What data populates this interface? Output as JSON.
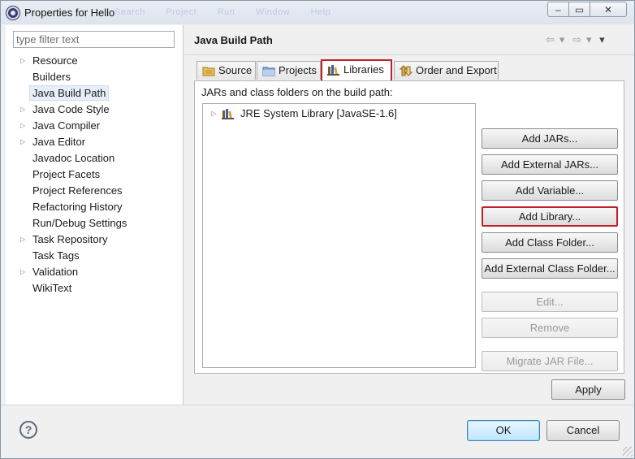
{
  "window": {
    "title": "Properties for Hello",
    "ghost_menu": [
      "Search",
      "Project",
      "Run",
      "Window",
      "Help"
    ],
    "controls": {
      "minimize": "–",
      "maximize": "▭",
      "close": "✕"
    }
  },
  "sidebar": {
    "filter_placeholder": "type filter text",
    "items": [
      {
        "label": "Resource",
        "expandable": true
      },
      {
        "label": "Builders",
        "expandable": false
      },
      {
        "label": "Java Build Path",
        "expandable": false,
        "selected": true
      },
      {
        "label": "Java Code Style",
        "expandable": true
      },
      {
        "label": "Java Compiler",
        "expandable": true
      },
      {
        "label": "Java Editor",
        "expandable": true
      },
      {
        "label": "Javadoc Location",
        "expandable": false
      },
      {
        "label": "Project Facets",
        "expandable": false
      },
      {
        "label": "Project References",
        "expandable": false
      },
      {
        "label": "Refactoring History",
        "expandable": false
      },
      {
        "label": "Run/Debug Settings",
        "expandable": false
      },
      {
        "label": "Task Repository",
        "expandable": true
      },
      {
        "label": "Task Tags",
        "expandable": false
      },
      {
        "label": "Validation",
        "expandable": true
      },
      {
        "label": "WikiText",
        "expandable": false
      }
    ]
  },
  "main": {
    "title": "Java Build Path",
    "nav": {
      "back": "⇦",
      "back_menu": "▾",
      "forward": "⇨",
      "forward_menu": "▾",
      "view_menu": "▾"
    },
    "tabs": [
      {
        "label": "Source",
        "icon": "source-folder-icon"
      },
      {
        "label": "Projects",
        "icon": "project-folder-icon"
      },
      {
        "label": "Libraries",
        "icon": "library-icon",
        "active": true
      },
      {
        "label": "Order and Export",
        "icon": "order-export-icon"
      }
    ],
    "body_label": "JARs and class folders on the build path:",
    "tree": [
      {
        "label": "JRE System Library [JavaSE-1.6]",
        "icon": "library-icon",
        "expandable": true
      }
    ],
    "buttons": [
      {
        "label": "Add JARs...",
        "enabled": true
      },
      {
        "label": "Add External JARs...",
        "enabled": true
      },
      {
        "label": "Add Variable...",
        "enabled": true
      },
      {
        "label": "Add Library...",
        "enabled": true,
        "highlighted": true
      },
      {
        "label": "Add Class Folder...",
        "enabled": true
      },
      {
        "label": "Add External Class Folder...",
        "enabled": true
      },
      {
        "label": "Edit...",
        "enabled": false
      },
      {
        "label": "Remove",
        "enabled": false
      },
      {
        "label": "Migrate JAR File...",
        "enabled": false
      }
    ],
    "apply_label": "Apply"
  },
  "footer": {
    "help_label": "?",
    "ok_label": "OK",
    "cancel_label": "Cancel"
  },
  "colors": {
    "highlight_border": "#c0202a",
    "selection_bg": "#e5eef9",
    "ok_button": "#bee6fd"
  }
}
